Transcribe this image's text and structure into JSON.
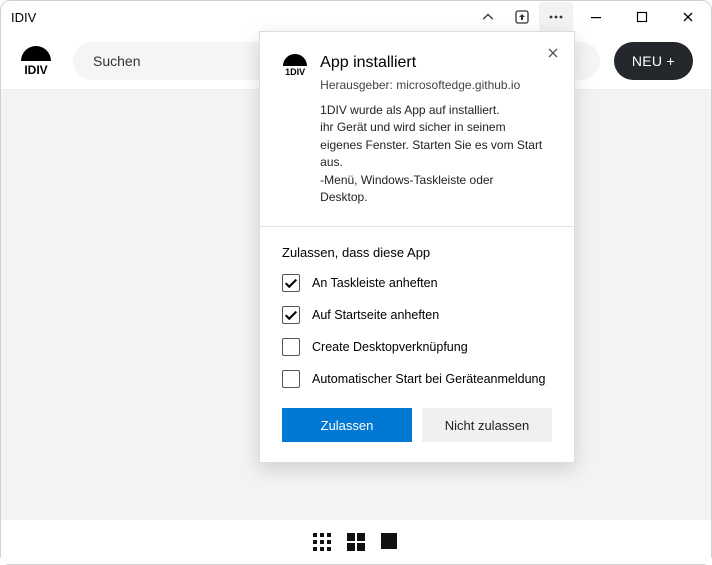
{
  "window": {
    "title": "IDIV"
  },
  "logo": {
    "text": "IDIV"
  },
  "search": {
    "placeholder": "Suchen"
  },
  "actions": {
    "new_label": "NEU +"
  },
  "popover": {
    "icon_label": "1DIV",
    "title": "App installiert",
    "publisher": "Herausgeber: microsoftedge.github.io",
    "body_lines": [
      "1DIV wurde als App auf installiert.",
      "ihr Gerät und wird sicher in seinem",
      "eigenes Fenster. Starten Sie es vom Start aus.",
      "-Menü, Windows-Taskleiste oder",
      "Desktop."
    ],
    "permissions_title": "Zulassen, dass diese App",
    "options": [
      {
        "label": "An Taskleiste anheften",
        "checked": true
      },
      {
        "label": "Auf Startseite anheften",
        "checked": true
      },
      {
        "label": "Create Desktopverknüpfung",
        "checked": false
      },
      {
        "label": "Automatischer Start bei Geräteanmeldung",
        "checked": false
      }
    ],
    "allow": "Zulassen",
    "deny": "Nicht zulassen"
  }
}
